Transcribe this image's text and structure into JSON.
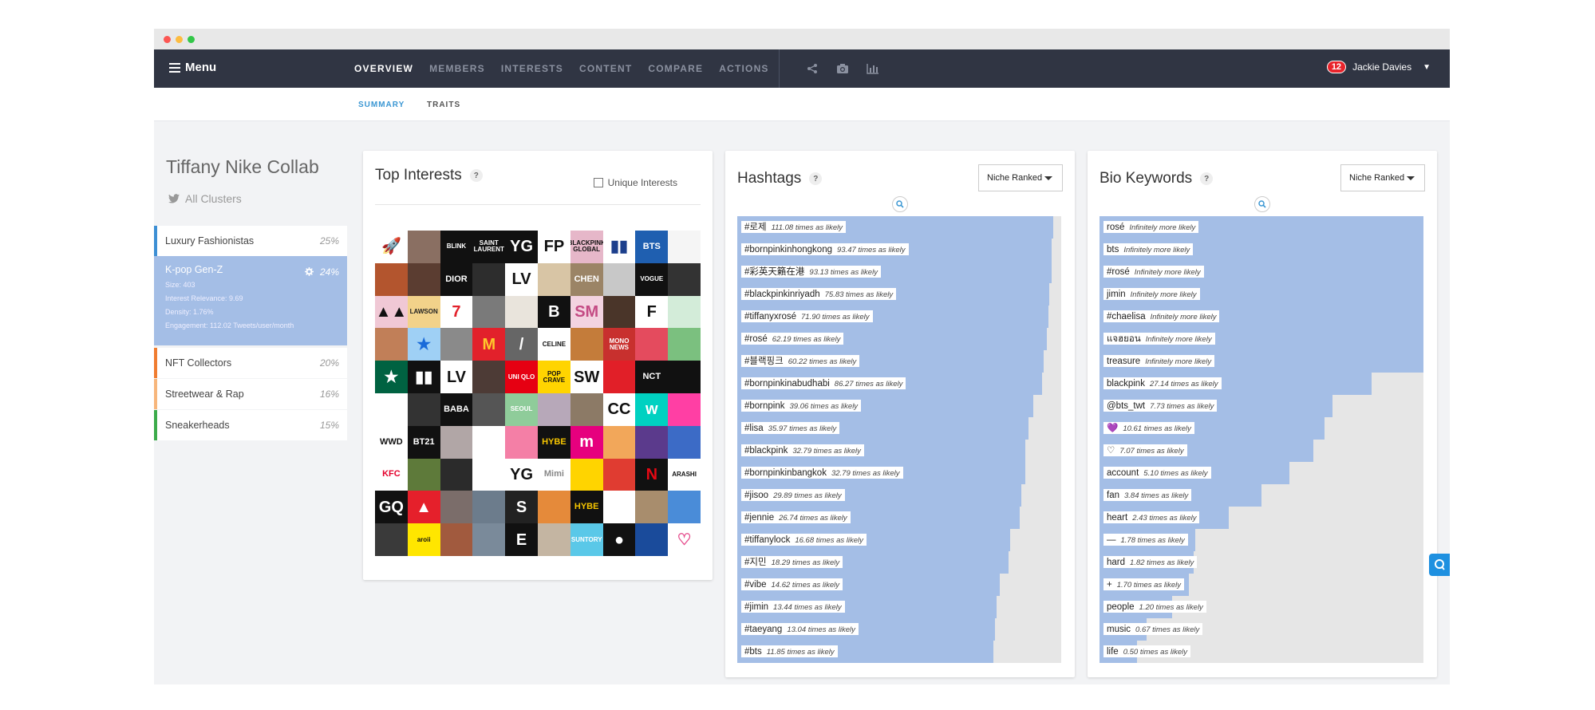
{
  "nav": {
    "menu_label": "Menu",
    "tabs": [
      "OVERVIEW",
      "MEMBERS",
      "INTERESTS",
      "CONTENT",
      "COMPARE",
      "ACTIONS"
    ],
    "icons": [
      "share-icon",
      "camera-icon",
      "bar-chart-icon"
    ],
    "notification_count": "12",
    "user_name": "Jackie Davies"
  },
  "subnav": {
    "summary": "SUMMARY",
    "traits": "TRAITS"
  },
  "sidebar": {
    "title": "Tiffany Nike Collab",
    "clusters_link": "All Clusters",
    "clusters": [
      {
        "name": "Luxury Fashionistas",
        "pct": "25%",
        "color": "#3d8fd4"
      },
      {
        "name": "K-pop Gen-Z",
        "pct": "24%",
        "color": "#a4bee6",
        "details": [
          "Size: 403",
          "Interest Relevance: 9.69",
          "Density: 1.76%",
          "Engagement: 112.02 Tweets/user/month"
        ]
      },
      {
        "name": "NFT Collectors",
        "pct": "20%",
        "color": "#f07c30"
      },
      {
        "name": "Streetwear & Rap",
        "pct": "16%",
        "color": "#f7b67b"
      },
      {
        "name": "Sneakerheads",
        "pct": "15%",
        "color": "#3cab4a"
      }
    ]
  },
  "interests": {
    "title": "Top Interests",
    "help": "?",
    "unique_label": "Unique Interests",
    "tiles": [
      {
        "bg": "#ffffff",
        "fg": "#2bb6d8",
        "t": "🚀"
      },
      {
        "bg": "#8a6f62",
        "fg": "#fff",
        "t": ""
      },
      {
        "bg": "#111111",
        "fg": "#fff",
        "t": "BLINK"
      },
      {
        "bg": "#111111",
        "fg": "#fff",
        "t": "SAINT LAURENT"
      },
      {
        "bg": "#111111",
        "fg": "#fff",
        "t": "YG"
      },
      {
        "bg": "#ffffff",
        "fg": "#111",
        "t": "FP"
      },
      {
        "bg": "#e6b7c9",
        "fg": "#111",
        "t": "BLACKPINK GLOBAL"
      },
      {
        "bg": "#ffffff",
        "fg": "#1c3f8c",
        "t": "▮▮"
      },
      {
        "bg": "#1f5fb0",
        "fg": "#fff",
        "t": "BTS"
      },
      {
        "bg": "#f5f5f5",
        "fg": "#444",
        "t": ""
      },
      {
        "bg": "#b3552e",
        "fg": "#fff",
        "t": ""
      },
      {
        "bg": "#5b3d31",
        "fg": "#fff",
        "t": ""
      },
      {
        "bg": "#111111",
        "fg": "#fff",
        "t": "DIOR"
      },
      {
        "bg": "#2d2d2d",
        "fg": "#fff",
        "t": ""
      },
      {
        "bg": "#ffffff",
        "fg": "#111",
        "t": "LV"
      },
      {
        "bg": "#d8c5a5",
        "fg": "#333",
        "t": ""
      },
      {
        "bg": "#9b8466",
        "fg": "#fff",
        "t": "CHEN"
      },
      {
        "bg": "#c8c8c8",
        "fg": "#333",
        "t": ""
      },
      {
        "bg": "#111111",
        "fg": "#fff",
        "t": "VOGUE"
      },
      {
        "bg": "#333333",
        "fg": "#fff",
        "t": ""
      },
      {
        "bg": "#f0c8d5",
        "fg": "#111",
        "t": "▲▲"
      },
      {
        "bg": "#f2d28a",
        "fg": "#222",
        "t": "LAWSON"
      },
      {
        "bg": "#ffffff",
        "fg": "#e2212b",
        "t": "7"
      },
      {
        "bg": "#7a7a7a",
        "fg": "#fff",
        "t": ""
      },
      {
        "bg": "#e9e4dc",
        "fg": "#333",
        "t": ""
      },
      {
        "bg": "#111111",
        "fg": "#fff",
        "t": "B"
      },
      {
        "bg": "#f3d3e0",
        "fg": "#c44b84",
        "t": "SM"
      },
      {
        "bg": "#4a3529",
        "fg": "#fff",
        "t": ""
      },
      {
        "bg": "#ffffff",
        "fg": "#111",
        "t": "F"
      },
      {
        "bg": "#d3ecd9",
        "fg": "#333",
        "t": ""
      },
      {
        "bg": "#c17f58",
        "fg": "#fff",
        "t": ""
      },
      {
        "bg": "#9fd0f5",
        "fg": "#1b6bd9",
        "t": "★"
      },
      {
        "bg": "#8a8a8a",
        "fg": "#fff",
        "t": ""
      },
      {
        "bg": "#e2212b",
        "fg": "#ffc72c",
        "t": "M"
      },
      {
        "bg": "#666666",
        "fg": "#fff",
        "t": "/"
      },
      {
        "bg": "#ffffff",
        "fg": "#111",
        "t": "CELINE"
      },
      {
        "bg": "#c47c3a",
        "fg": "#fff",
        "t": ""
      },
      {
        "bg": "#c8302e",
        "fg": "#fff",
        "t": "MONO NEWS"
      },
      {
        "bg": "#e44b5e",
        "fg": "#fff",
        "t": ""
      },
      {
        "bg": "#7bc07f",
        "fg": "#fff",
        "t": ""
      },
      {
        "bg": "#006241",
        "fg": "#fff",
        "t": "★"
      },
      {
        "bg": "#111111",
        "fg": "#fff",
        "t": "▮▮"
      },
      {
        "bg": "#ffffff",
        "fg": "#111",
        "t": "LV"
      },
      {
        "bg": "#4d3b36",
        "fg": "#fff",
        "t": ""
      },
      {
        "bg": "#e60012",
        "fg": "#fff",
        "t": "UNI QLO"
      },
      {
        "bg": "#ffd400",
        "fg": "#111",
        "t": "POP CRAVE"
      },
      {
        "bg": "#ffffff",
        "fg": "#111",
        "t": "SW"
      },
      {
        "bg": "#e11f28",
        "fg": "#fff",
        "t": ""
      },
      {
        "bg": "#111111",
        "fg": "#fff",
        "t": "NCT"
      },
      {
        "bg": "#111111",
        "fg": "#fff",
        "t": ""
      },
      {
        "bg": "#ffffff",
        "fg": "#111",
        "t": ""
      },
      {
        "bg": "#333333",
        "fg": "#fff",
        "t": ""
      },
      {
        "bg": "#111111",
        "fg": "#fff",
        "t": "BABA"
      },
      {
        "bg": "#555555",
        "fg": "#fff",
        "t": ""
      },
      {
        "bg": "#8fcc9a",
        "fg": "#fff",
        "t": "SEOUL"
      },
      {
        "bg": "#b7a8b9",
        "fg": "#fff",
        "t": ""
      },
      {
        "bg": "#8c7a66",
        "fg": "#fff",
        "t": ""
      },
      {
        "bg": "#ffffff",
        "fg": "#111",
        "t": "CC"
      },
      {
        "bg": "#00d1c1",
        "fg": "#fff",
        "t": "w"
      },
      {
        "bg": "#ff3fa4",
        "fg": "#fff",
        "t": ""
      },
      {
        "bg": "#ffffff",
        "fg": "#111",
        "t": "WWD"
      },
      {
        "bg": "#111111",
        "fg": "#fff",
        "t": "BT21"
      },
      {
        "bg": "#b1a6a6",
        "fg": "#fff",
        "t": ""
      },
      {
        "bg": "#ffffff",
        "fg": "#333",
        "t": ""
      },
      {
        "bg": "#f47fa6",
        "fg": "#fff",
        "t": ""
      },
      {
        "bg": "#111111",
        "fg": "#f7c600",
        "t": "HYBE"
      },
      {
        "bg": "#e6007e",
        "fg": "#fff",
        "t": "m"
      },
      {
        "bg": "#f2a75a",
        "fg": "#fff",
        "t": ""
      },
      {
        "bg": "#5b3a8c",
        "fg": "#fff",
        "t": ""
      },
      {
        "bg": "#3c6bc6",
        "fg": "#fff",
        "t": ""
      },
      {
        "bg": "#ffffff",
        "fg": "#e4002b",
        "t": "KFC"
      },
      {
        "bg": "#5e7a3a",
        "fg": "#fff",
        "t": ""
      },
      {
        "bg": "#2b2b2b",
        "fg": "#fff",
        "t": ""
      },
      {
        "bg": "#ffffff",
        "fg": "#333",
        "t": ""
      },
      {
        "bg": "#ffffff",
        "fg": "#111",
        "t": "YG"
      },
      {
        "bg": "#ffffff",
        "fg": "#888",
        "t": "Mimi"
      },
      {
        "bg": "#ffd400",
        "fg": "#111",
        "t": ""
      },
      {
        "bg": "#e03c31",
        "fg": "#fff",
        "t": ""
      },
      {
        "bg": "#111111",
        "fg": "#e50914",
        "t": "N"
      },
      {
        "bg": "#ffffff",
        "fg": "#111",
        "t": "ARASHI"
      },
      {
        "bg": "#111111",
        "fg": "#fff",
        "t": "GQ"
      },
      {
        "bg": "#e5202b",
        "fg": "#fff",
        "t": "▲"
      },
      {
        "bg": "#7b6d6a",
        "fg": "#fff",
        "t": ""
      },
      {
        "bg": "#6c7c8c",
        "fg": "#fff",
        "t": ""
      },
      {
        "bg": "#222222",
        "fg": "#fff",
        "t": "S"
      },
      {
        "bg": "#e58a3a",
        "fg": "#fff",
        "t": ""
      },
      {
        "bg": "#111111",
        "fg": "#f7c600",
        "t": "HYBE"
      },
      {
        "bg": "#ffffff",
        "fg": "#c4262e",
        "t": ""
      },
      {
        "bg": "#a88d6d",
        "fg": "#fff",
        "t": ""
      },
      {
        "bg": "#4a8cd8",
        "fg": "#fff",
        "t": ""
      },
      {
        "bg": "#3a3a3a",
        "fg": "#fff",
        "t": ""
      },
      {
        "bg": "#ffe600",
        "fg": "#111",
        "t": "aroii"
      },
      {
        "bg": "#a15a3e",
        "fg": "#fff",
        "t": ""
      },
      {
        "bg": "#7a8a9a",
        "fg": "#fff",
        "t": ""
      },
      {
        "bg": "#111111",
        "fg": "#fff",
        "t": "E"
      },
      {
        "bg": "#c4b5a2",
        "fg": "#fff",
        "t": ""
      },
      {
        "bg": "#5ac8e8",
        "fg": "#fff",
        "t": "SUNTORY"
      },
      {
        "bg": "#111111",
        "fg": "#fff",
        "t": "●"
      },
      {
        "bg": "#1a4b9b",
        "fg": "#fff",
        "t": ""
      },
      {
        "bg": "#ffffff",
        "fg": "#e54b8c",
        "t": "♡"
      }
    ]
  },
  "hashtags": {
    "title": "Hashtags",
    "help": "?",
    "sort_label": "Niche Ranked",
    "rows": [
      {
        "label": "#로제",
        "sub": "111.08 times as likely",
        "value": 111.08
      },
      {
        "label": "#bornpinkinhongkong",
        "sub": "93.47 times as likely",
        "value": 93.47
      },
      {
        "label": "#彩英天籟在港",
        "sub": "93.13 times as likely",
        "value": 93.13
      },
      {
        "label": "#blackpinkinriyadh",
        "sub": "75.83 times as likely",
        "value": 75.83
      },
      {
        "label": "#tiffanyxrosé",
        "sub": "71.90 times as likely",
        "value": 71.9
      },
      {
        "label": "#rosé",
        "sub": "62.19 times as likely",
        "value": 62.19
      },
      {
        "label": "#블랙핑크",
        "sub": "60.22 times as likely",
        "value": 60.22
      },
      {
        "label": "#bornpinkinabudhabi",
        "sub": "86.27 times as likely",
        "value": 59.5
      },
      {
        "label": "#bornpink",
        "sub": "39.06 times as likely",
        "value": 39.06
      },
      {
        "label": "#lisa",
        "sub": "35.97 times as likely",
        "value": 35.97
      },
      {
        "label": "#blackpink",
        "sub": "32.79 times as likely",
        "value": 32.79
      },
      {
        "label": "#bornpinkinbangkok",
        "sub": "32.79 times as likely",
        "value": 32.79
      },
      {
        "label": "#jisoo",
        "sub": "29.89 times as likely",
        "value": 29.89
      },
      {
        "label": "#jennie",
        "sub": "26.74 times as likely",
        "value": 26.74
      },
      {
        "label": "#tiffanylock",
        "sub": "16.68 times as likely",
        "value": 16.68
      },
      {
        "label": "#지민",
        "sub": "18.29 times as likely",
        "value": 16.0
      },
      {
        "label": "#vibe",
        "sub": "14.62 times as likely",
        "value": 14.62
      },
      {
        "label": "#jimin",
        "sub": "13.44 times as likely",
        "value": 13.44
      },
      {
        "label": "#taeyang",
        "sub": "13.04 times as likely",
        "value": 13.04
      },
      {
        "label": "#bts",
        "sub": "11.85 times as likely",
        "value": 11.85
      }
    ],
    "fill_fractions": [
      0.975,
      0.97,
      0.97,
      0.963,
      0.96,
      0.955,
      0.945,
      0.94,
      0.915,
      0.898,
      0.89,
      0.89,
      0.878,
      0.872,
      0.843,
      0.838,
      0.81,
      0.8,
      0.795,
      0.79
    ]
  },
  "bio": {
    "title": "Bio Keywords",
    "help": "?",
    "sort_label": "Niche Ranked",
    "rows": [
      {
        "label": "rosé",
        "sub": "Infinitely more likely"
      },
      {
        "label": "bts",
        "sub": "Infinitely more likely"
      },
      {
        "label": "#rosé",
        "sub": "Infinitely more likely"
      },
      {
        "label": "jimin",
        "sub": "Infinitely more likely"
      },
      {
        "label": "#chaelisa",
        "sub": "Infinitely more likely"
      },
      {
        "label": "แจฮยอน",
        "sub": "Infinitely more likely"
      },
      {
        "label": "treasure",
        "sub": "Infinitely more likely"
      },
      {
        "label": "blackpink",
        "sub": "27.14 times as likely"
      },
      {
        "label": "@bts_twt",
        "sub": "7.73 times as likely"
      },
      {
        "label": "💜",
        "sub": "10.61 times as likely"
      },
      {
        "label": "♡",
        "sub": "7.07 times as likely"
      },
      {
        "label": "account",
        "sub": "5.10 times as likely"
      },
      {
        "label": "fan",
        "sub": "3.84 times as likely"
      },
      {
        "label": "heart",
        "sub": "2.43 times as likely"
      },
      {
        "label": "—",
        "sub": "1.78 times as likely"
      },
      {
        "label": "hard",
        "sub": "1.82 times as likely"
      },
      {
        "label": "+",
        "sub": "1.70 times as likely"
      },
      {
        "label": "people",
        "sub": "1.20 times as likely"
      },
      {
        "label": "music",
        "sub": "0.67 times as likely"
      },
      {
        "label": "life",
        "sub": "0.50 times as likely"
      }
    ],
    "fill_fractions": [
      1,
      1,
      1,
      1,
      1,
      1,
      1,
      0.84,
      0.72,
      0.695,
      0.66,
      0.585,
      0.5,
      0.4,
      0.295,
      0.29,
      0.275,
      0.225,
      0.145,
      0.115
    ]
  },
  "colors": {
    "bar_fill": "#a4bee6",
    "bar_track": "#e6e6e6",
    "accent": "#3b97d3",
    "navbar": "#303543"
  }
}
